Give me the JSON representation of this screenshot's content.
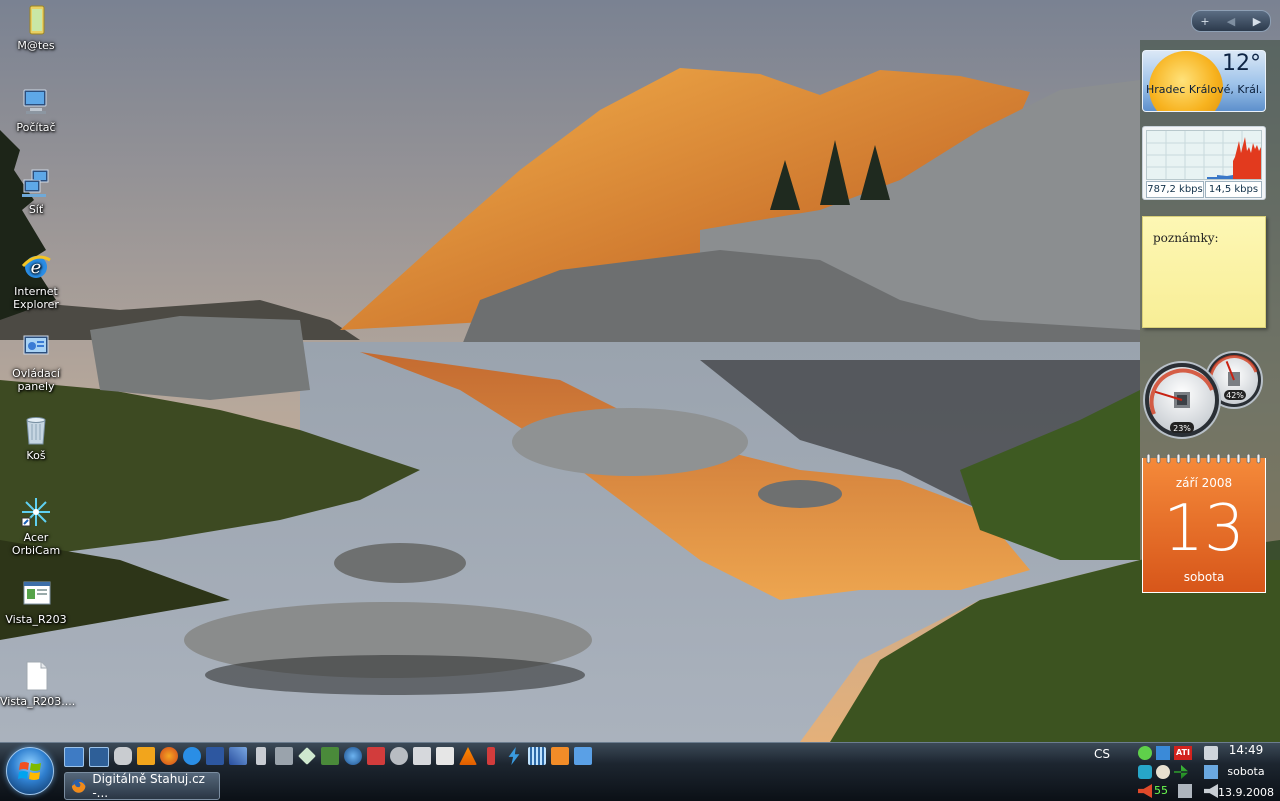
{
  "desktop": {
    "icons": [
      {
        "label": "M@tes",
        "icon": "folder-icon"
      },
      {
        "label": "Počítač",
        "icon": "computer-icon"
      },
      {
        "label": "Síť",
        "icon": "network-icon"
      },
      {
        "label": "Internet Explorer",
        "icon": "internet-explorer-icon"
      },
      {
        "label": "Ovládací panely",
        "icon": "control-panel-icon"
      },
      {
        "label": "Koš",
        "icon": "recycle-bin-icon"
      },
      {
        "label": "Acer OrbiCam",
        "icon": "webcam-icon"
      },
      {
        "label": "Vista_R203",
        "icon": "document-icon"
      },
      {
        "label": "Vista_R203....",
        "icon": "blank-file-icon"
      }
    ]
  },
  "sidebar": {
    "controls": {
      "add": "+",
      "prev": "◀",
      "next": "▶"
    },
    "weather": {
      "temperature": "12°",
      "location": "Hradec Králové, Král..."
    },
    "network": {
      "down_speed": "787,2 kbps",
      "up_speed": "14,5 kbps"
    },
    "notes": {
      "text": "poznámky:"
    },
    "meters": {
      "cpu_percent": "23%",
      "memory_percent": "42%",
      "cpu_value": 0.23,
      "memory_value": 0.42
    },
    "calendar": {
      "month_year": "září 2008",
      "day": "13",
      "weekday": "sobota"
    }
  },
  "taskbar": {
    "task_button": "Digitálně Stahuj.cz -...",
    "language": "CS",
    "tray_number": "55",
    "clock": {
      "time": "14:49",
      "weekday": "sobota",
      "date": "13.9.2008"
    }
  },
  "colors": {
    "calendar_orange": "#e8682a",
    "notes_yellow": "#fbf3a4",
    "net_graph_red": "#e23a1e",
    "tray_green": "#6cff4f"
  }
}
